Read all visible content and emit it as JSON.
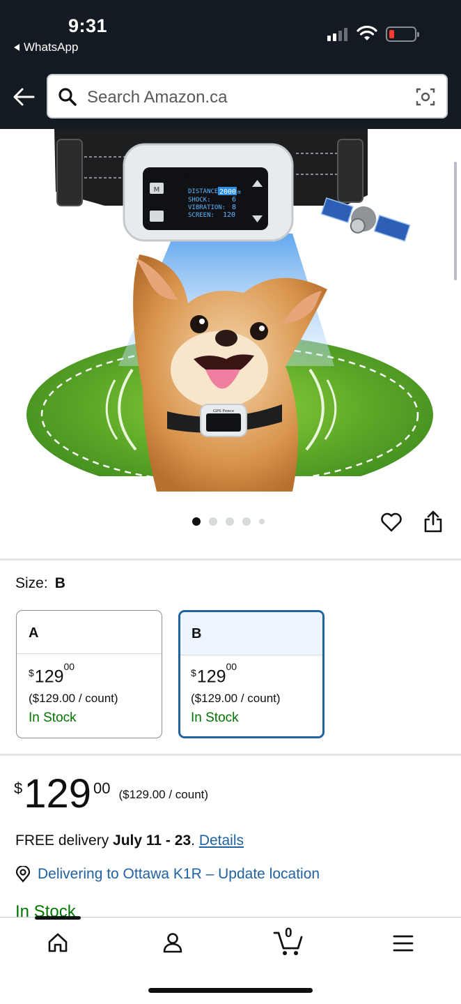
{
  "status_bar": {
    "time": "9:31",
    "back_app": "WhatsApp",
    "icons": [
      "cellular-signal-icon",
      "wifi-icon",
      "battery-low-icon"
    ]
  },
  "header": {
    "back_icon": "back-arrow-icon",
    "search_placeholder": "Search Amazon.ca",
    "search_icon": "search-icon",
    "camera_icon": "camera-search-icon"
  },
  "product_image": {
    "collar_screen_title": "GPS Fence",
    "collar_readout": [
      {
        "label": "DISTANCE:",
        "value": "2000",
        "unit": "m"
      },
      {
        "label": "SHOCK:",
        "value": "6"
      },
      {
        "label": "VIBRATION:",
        "value": "8"
      },
      {
        "label": "SCREEN:",
        "value": "120"
      }
    ],
    "collar_buttons": [
      "M"
    ],
    "small_collar_title": "GPS Fence",
    "image_count": 5,
    "current_image": 1
  },
  "actions": {
    "favorite_icon": "heart-icon",
    "share_icon": "share-icon"
  },
  "size": {
    "label": "Size:",
    "selected": "B",
    "options": [
      {
        "name": "A",
        "currency": "$",
        "whole": "129",
        "fraction": "00",
        "unit_price": "($129.00 / count)",
        "stock": "In Stock",
        "selected": false
      },
      {
        "name": "B",
        "currency": "$",
        "whole": "129",
        "fraction": "00",
        "unit_price": "($129.00 / count)",
        "stock": "In Stock",
        "selected": true
      }
    ]
  },
  "price": {
    "currency": "$",
    "whole": "129",
    "fraction": "00",
    "unit_price": "($129.00 / count)"
  },
  "delivery": {
    "prefix": "FREE delivery",
    "dates": "July 11 - 23",
    "separator": ".",
    "details_link": "Details",
    "location_icon": "location-pin-icon",
    "location_text": "Delivering to Ottawa K1R – Update location",
    "stock": "In Stock"
  },
  "tabbar": {
    "tabs": [
      {
        "name": "home",
        "icon": "home-icon",
        "active": true
      },
      {
        "name": "account",
        "icon": "person-icon",
        "active": false
      },
      {
        "name": "cart",
        "icon": "cart-icon",
        "count": "0",
        "active": false
      },
      {
        "name": "menu",
        "icon": "hamburger-menu-icon",
        "active": false
      }
    ]
  },
  "colors": {
    "header_bg": "#131a22",
    "link": "#2162a1",
    "in_stock": "#007600",
    "selected_border": "#2162a1",
    "selected_bg": "#edf6ff"
  }
}
